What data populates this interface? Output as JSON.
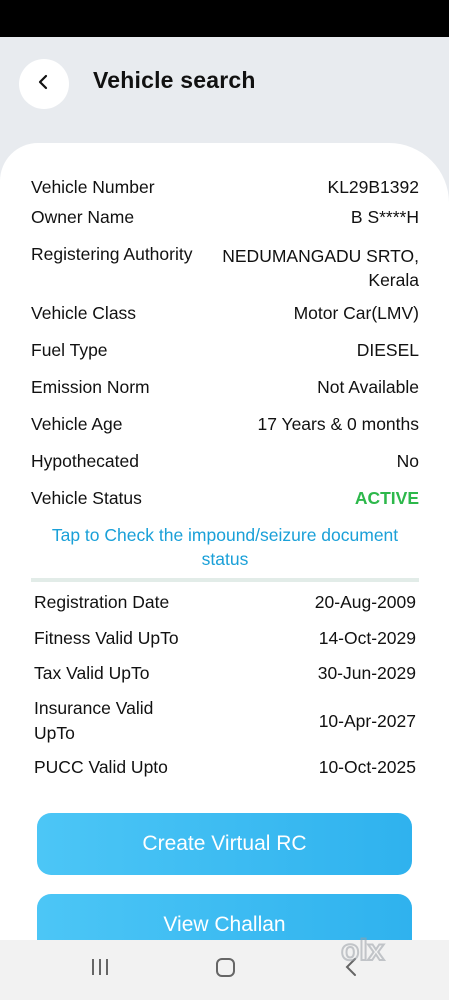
{
  "header": {
    "title": "Vehicle search"
  },
  "vehicle": [
    {
      "label": "Vehicle Number",
      "value": "KL29B1392"
    },
    {
      "label": "Owner Name",
      "value": "B S****H"
    },
    {
      "label": "Registering Authority",
      "value": "NEDUMANGADU SRTO,\nKerala"
    },
    {
      "label": "Vehicle Class",
      "value": "Motor Car(LMV)"
    },
    {
      "label": "Fuel Type",
      "value": "DIESEL"
    },
    {
      "label": "Emission Norm",
      "value": "Not Available"
    },
    {
      "label": "Vehicle Age",
      "value": "17 Years  & 0 months"
    },
    {
      "label": "Hypothecated",
      "value": "No"
    },
    {
      "label": "Vehicle Status",
      "value": "ACTIVE"
    }
  ],
  "impound_link": "Tap to Check the impound/seizure document status",
  "validity": [
    {
      "label": "Registration Date",
      "value": "20-Aug-2009"
    },
    {
      "label": "Fitness Valid UpTo",
      "value": "14-Oct-2029"
    },
    {
      "label": "Tax Valid UpTo",
      "value": "30-Jun-2029"
    },
    {
      "label": "Insurance Valid UpTo",
      "value": "10-Apr-2027"
    },
    {
      "label": "PUCC Valid Upto",
      "value": "10-Oct-2025"
    }
  ],
  "buttons": {
    "create_rc": "Create Virtual RC",
    "view_challan": "View Challan"
  },
  "watermark": "olx",
  "colors": {
    "accent": "#1aa0d8",
    "status_active": "#2db84b",
    "button": "#3bbaf2"
  },
  "icons": {
    "back": "chevron-left-icon",
    "recents": "recents-icon",
    "home": "home-icon",
    "nav_back": "back-icon"
  }
}
